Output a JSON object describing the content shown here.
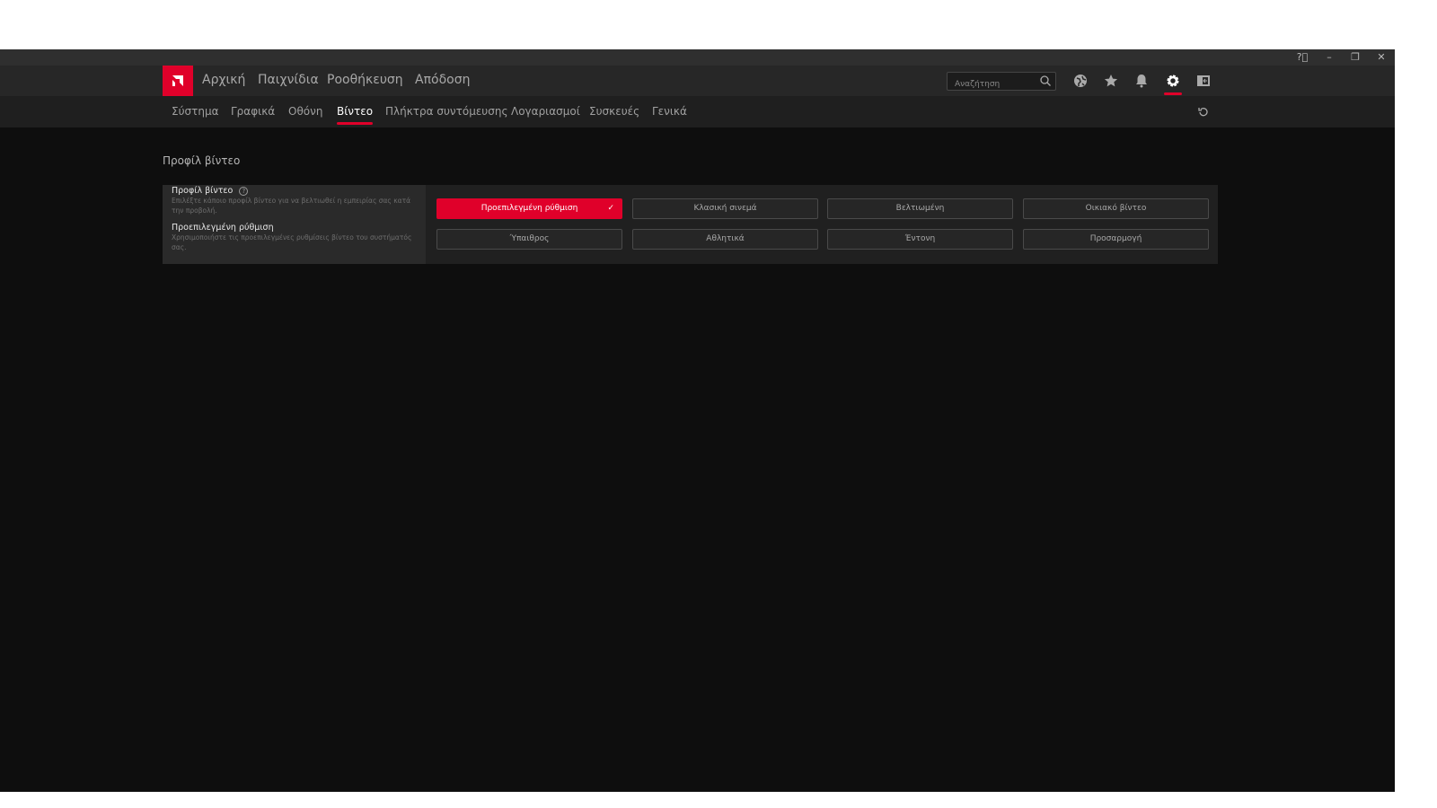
{
  "window": {
    "controls": [
      "help-icon",
      "minimize-icon",
      "restore-icon",
      "close-icon"
    ]
  },
  "topnav": {
    "items": [
      "Αρχική",
      "Παιχνίδια",
      "Ροοθήκευση",
      "Απόδοση"
    ],
    "search_placeholder": "Αναζήτηση",
    "icons": [
      "globe-icon",
      "star-icon",
      "bell-icon",
      "gear-icon",
      "sidebar-icon"
    ],
    "active_icon": "gear-icon"
  },
  "subnav": {
    "tabs": [
      "Σύστημα",
      "Γραφικά",
      "Οθόνη",
      "Βίντεο",
      "Πλήκτρα συντόμευσης",
      "Λογαριασμοί",
      "Συσκευές",
      "Γενικά"
    ],
    "active": "Βίντεο",
    "reset_icon": "reset-icon"
  },
  "section_title": "Προφίλ βίντεο",
  "panel": {
    "title": "Προφίλ βίντεο",
    "description": "Επιλέξτε κάποιο προφίλ βίντεο για να βελτιωθεί η εμπειρίας σας κατά την προβολή.",
    "selected_title": "Προεπιλεγμένη ρύθμιση",
    "selected_description": "Χρησιμοποιήστε τις προεπιλεγμένες ρυθμίσεις βίντεο του συστήματός σας.",
    "options": [
      "Προεπιλεγμένη ρύθμιση",
      "Κλασική σινεμά",
      "Βελτιωμένη",
      "Οικιακό βίντεο",
      "Ύπαιθρος",
      "Αθλητικά",
      "Έντονη",
      "Προσαρμογή"
    ],
    "selected": "Προεπιλεγμένη ρύθμιση"
  },
  "colors": {
    "accent": "#e0002a",
    "background": "#0e0e0e"
  }
}
